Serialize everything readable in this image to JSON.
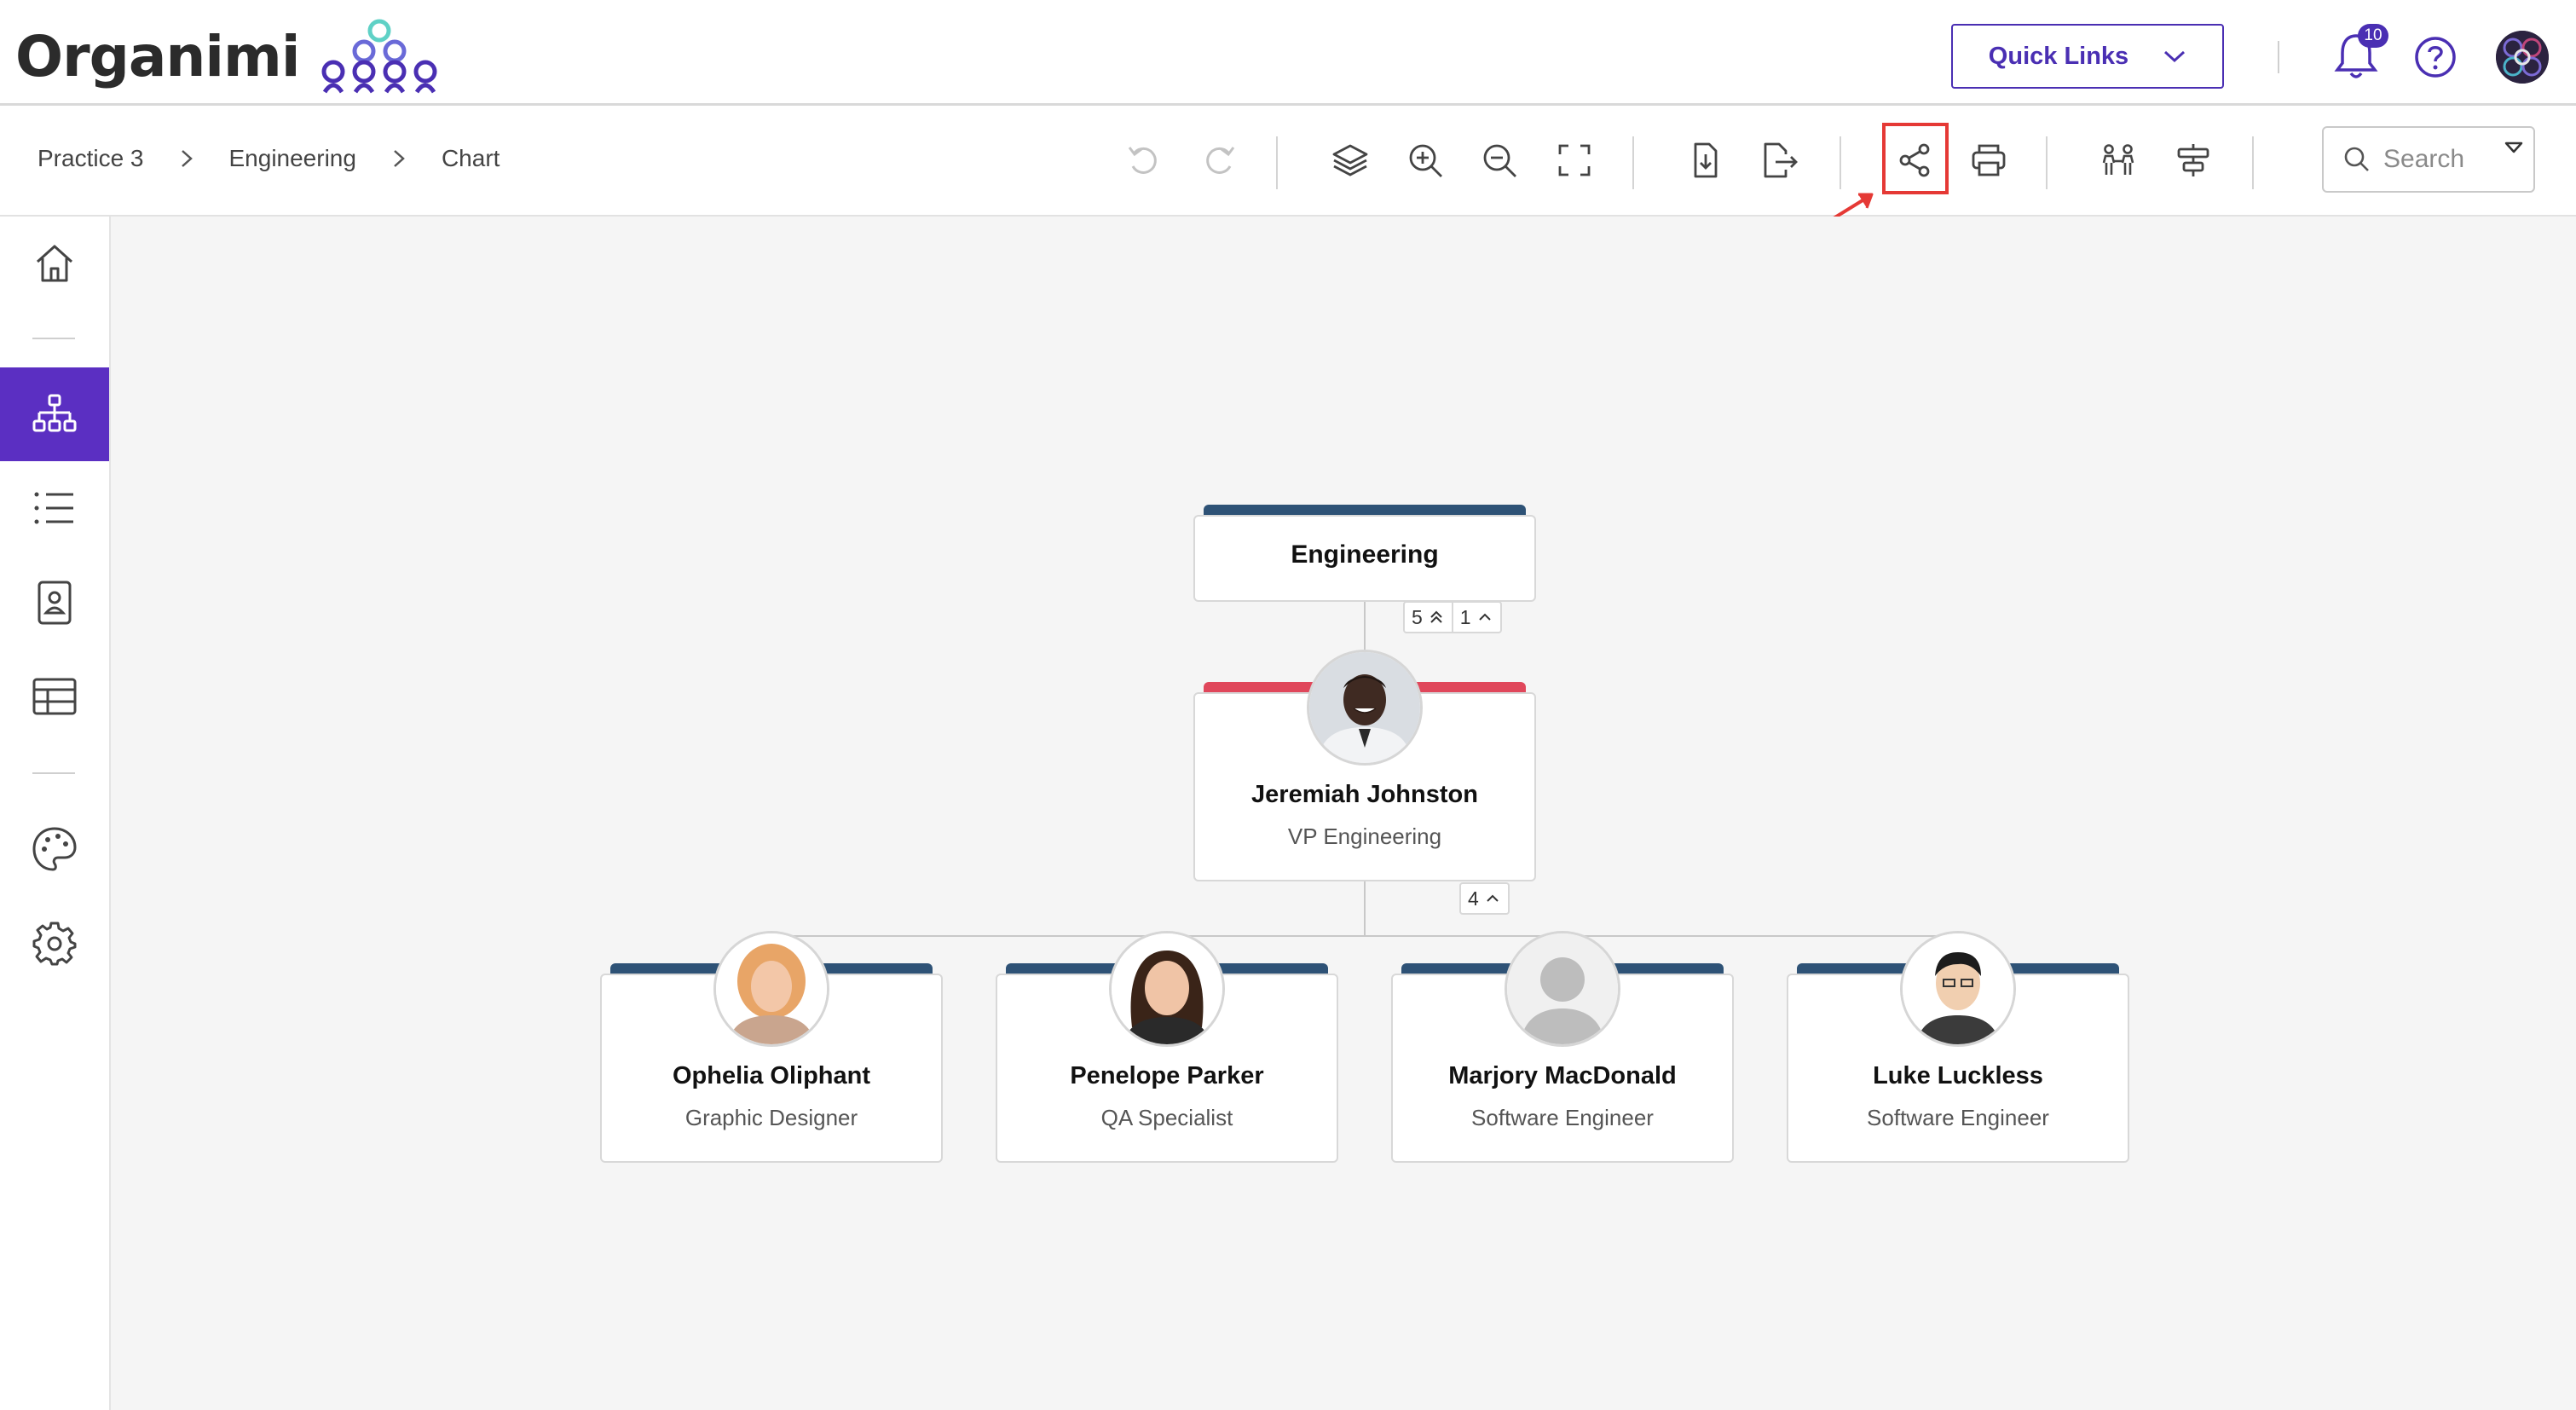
{
  "header": {
    "logo_text": "Organimi",
    "quick_links_label": "Quick Links",
    "notification_count": "10",
    "accent_color": "#4a2fb3"
  },
  "breadcrumb": [
    "Practice 3",
    "Engineering",
    "Chart"
  ],
  "toolbar": {
    "tools": [
      "undo-icon",
      "redo-icon",
      "layers-icon",
      "zoom-in-icon",
      "zoom-out-icon",
      "fit-screen-icon",
      "download-icon",
      "export-icon",
      "share-icon",
      "print-icon",
      "people-icon",
      "align-icon"
    ],
    "highlighted_tool": "share-icon",
    "search_placeholder": "Search"
  },
  "sidebar": {
    "items": [
      "home-icon",
      "org-chart-icon",
      "list-icon",
      "directory-icon",
      "table-icon",
      "palette-icon",
      "settings-icon"
    ],
    "active_item": "org-chart-icon",
    "active_color": "#5b2fc2"
  },
  "chart": {
    "department": {
      "name": "Engineering",
      "bar_color": "#2e5276",
      "counts": {
        "descendants": "5",
        "direct": "1"
      }
    },
    "manager": {
      "name": "Jeremiah Johnston",
      "title": "VP Engineering",
      "bar_color": "#e0475b",
      "direct_count": "4"
    },
    "reports": [
      {
        "name": "Ophelia Oliphant",
        "title": "Graphic Designer"
      },
      {
        "name": "Penelope Parker",
        "title": "QA Specialist"
      },
      {
        "name": "Marjory MacDonald",
        "title": "Software Engineer"
      },
      {
        "name": "Luke Luckless",
        "title": "Software Engineer"
      }
    ],
    "report_bar_color": "#2e5276"
  }
}
